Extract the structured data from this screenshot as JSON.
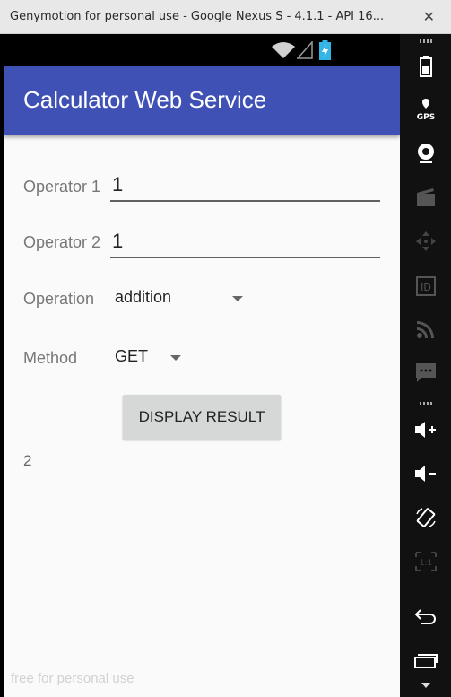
{
  "window": {
    "title": "Genymotion for personal use - Google Nexus S - 4.1.1 - API 16...",
    "close_glyph": "✕"
  },
  "app": {
    "title": "Calculator Web Service"
  },
  "form": {
    "operator1_label": "Operator 1",
    "operator1_value": "1",
    "operator2_label": "Operator 2",
    "operator2_value": "1",
    "operation_label": "Operation",
    "operation_value": "addition",
    "method_label": "Method",
    "method_value": "GET",
    "button_label": "DISPLAY RESULT",
    "result": "2"
  },
  "watermark": "free for personal use",
  "sidebar": {
    "gps_label": "GPS",
    "id_label": "ID",
    "pixel_label": "1:1",
    "icons": [
      "battery-icon",
      "gps-icon",
      "webcam-icon",
      "capture-icon",
      "dpad-icon",
      "id-icon",
      "rss-icon",
      "message-icon",
      "volume-up-icon",
      "volume-down-icon",
      "rotate-icon",
      "pixel-perfect-icon",
      "back-icon",
      "recent-apps-icon"
    ]
  },
  "colors": {
    "appbar": "#3f51b5",
    "screen_bg": "#fafafa",
    "button_bg": "#d6d7d7"
  }
}
